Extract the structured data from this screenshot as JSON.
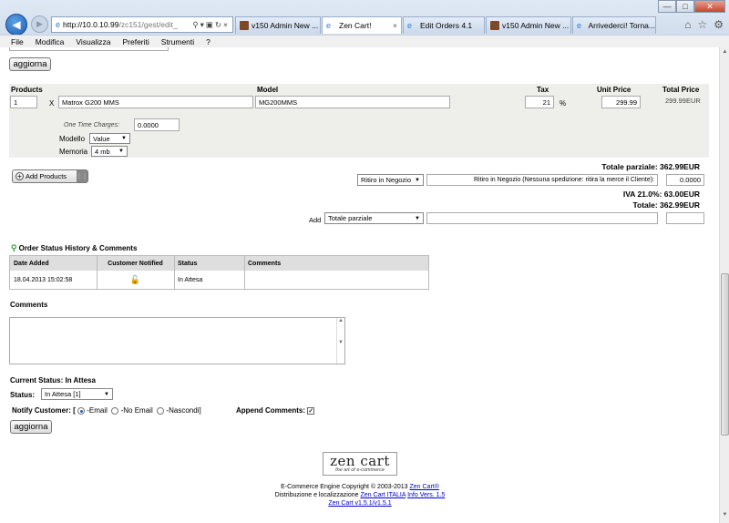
{
  "browser": {
    "address": {
      "host": "http://10.0.10.99",
      "path": "/zc151/gest/edit_"
    },
    "tabs": [
      {
        "label": "v150 Admin New ..."
      },
      {
        "label": "Zen Cart!"
      },
      {
        "label": "Edit Orders 4.1"
      },
      {
        "label": "v150 Admin New ..."
      },
      {
        "label": "Arrivederci! Torna..."
      }
    ],
    "menu": [
      "File",
      "Modifica",
      "Visualizza",
      "Preferiti",
      "Strumenti",
      "?"
    ]
  },
  "top": {
    "update_label": "aggiorna"
  },
  "products": {
    "headers": {
      "products": "Products",
      "model": "Model",
      "tax": "Tax",
      "unit_price": "Unit Price",
      "total_price": "Total Price"
    },
    "row": {
      "qty": "1",
      "times": "X",
      "name": "Matrox G200 MMS",
      "model": "MG200MMS",
      "tax": "21",
      "tax_unit": "%",
      "unit_price": "299.99",
      "total_price": "299.99EUR"
    },
    "one_time_label": "One Time Charges:",
    "one_time_value": "0.0000",
    "attributes": [
      {
        "label": "Modello",
        "value": "Value"
      },
      {
        "label": "Memoria",
        "value": "4 mb"
      }
    ]
  },
  "totals": {
    "add_products_label": "Add Products",
    "subtotal_label": "Totale parziale:",
    "subtotal_value": "362.99EUR",
    "shipping_select": "Ritiro in Negozio",
    "shipping_text": "Ritiro in Negozio (Nessuna spedizione: ritira la merce il Cliente):",
    "shipping_value": "0.0000",
    "vat_label": "IVA 21.0%:",
    "vat_value": "63.00EUR",
    "total_label": "Totale:",
    "total_value": "362.99EUR",
    "add_label": "Add",
    "add_select": "Totale parziale"
  },
  "history": {
    "title": "Order Status History & Comments",
    "headers": [
      "Date Added",
      "Customer Notified",
      "Status",
      "Comments"
    ],
    "rows": [
      {
        "date": "18.04.2013 15:02:58",
        "status": "In Attesa",
        "comments": ""
      }
    ]
  },
  "comments_label": "Comments",
  "status": {
    "current_label": "Current Status:",
    "current_value": "In Attesa",
    "status_label": "Status:",
    "status_select": "In Attesa [1]",
    "notify_label": "Notify Customer: [",
    "opt_email": "-Email",
    "opt_no_email": "-No Email",
    "opt_hide": "-Nascondi]",
    "append_label": "Append Comments:",
    "update_label": "aggiorna"
  },
  "logo": {
    "name": "zen cart",
    "tagline": "the art of e-commerce"
  },
  "footer": {
    "line1": "E-Commerce Engine Copyright © 2003-2013",
    "line1_link": "Zen Cart®",
    "line2": "Distribuzione e localizzazione",
    "line2_link1": "Zen Cart ITALIA",
    "line2_link2": "Info Vers. 1.5",
    "line3_link": "Zen Cart v1.5.1/v1.5.1"
  },
  "colors": {
    "row_bg": "#eeeeea",
    "header_bg": "#dedede",
    "link": "#0000cc"
  }
}
